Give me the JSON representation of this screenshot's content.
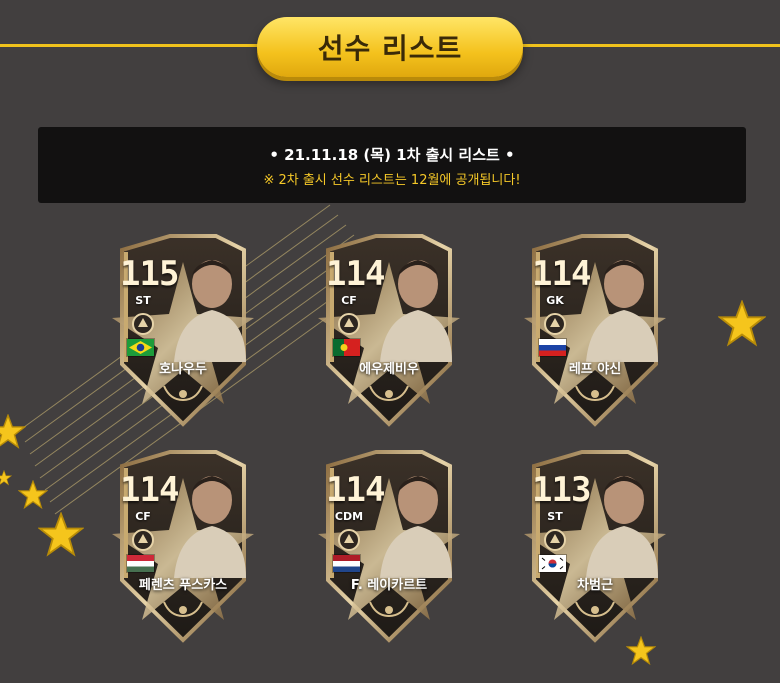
{
  "header": {
    "title": "선수 리스트"
  },
  "notice": {
    "line1": "• 21.11.18 (목) 1차 출시 리스트 •",
    "line2": "※ 2차 출시 선수 리스트는 12월에 공개됩니다!"
  },
  "colors": {
    "accent": "#f0c21c",
    "background": "#423f3f",
    "notice_bg": "#121111",
    "notice_sub": "#f5c828"
  },
  "cards": [
    {
      "ovr": "115",
      "position": "ST",
      "name": "호나우두",
      "flag": "brazil-flag"
    },
    {
      "ovr": "114",
      "position": "CF",
      "name": "에우제비우",
      "flag": "portugal-flag"
    },
    {
      "ovr": "114",
      "position": "GK",
      "name": "레프 야신",
      "flag": "russia-flag"
    },
    {
      "ovr": "114",
      "position": "CF",
      "name": "페렌츠 푸스카스",
      "flag": "hungary-flag"
    },
    {
      "ovr": "114",
      "position": "CDM",
      "name": "F. 레이카르트",
      "flag": "netherlands-flag"
    },
    {
      "ovr": "113",
      "position": "ST",
      "name": "차범근",
      "flag": "korea-flag"
    }
  ]
}
